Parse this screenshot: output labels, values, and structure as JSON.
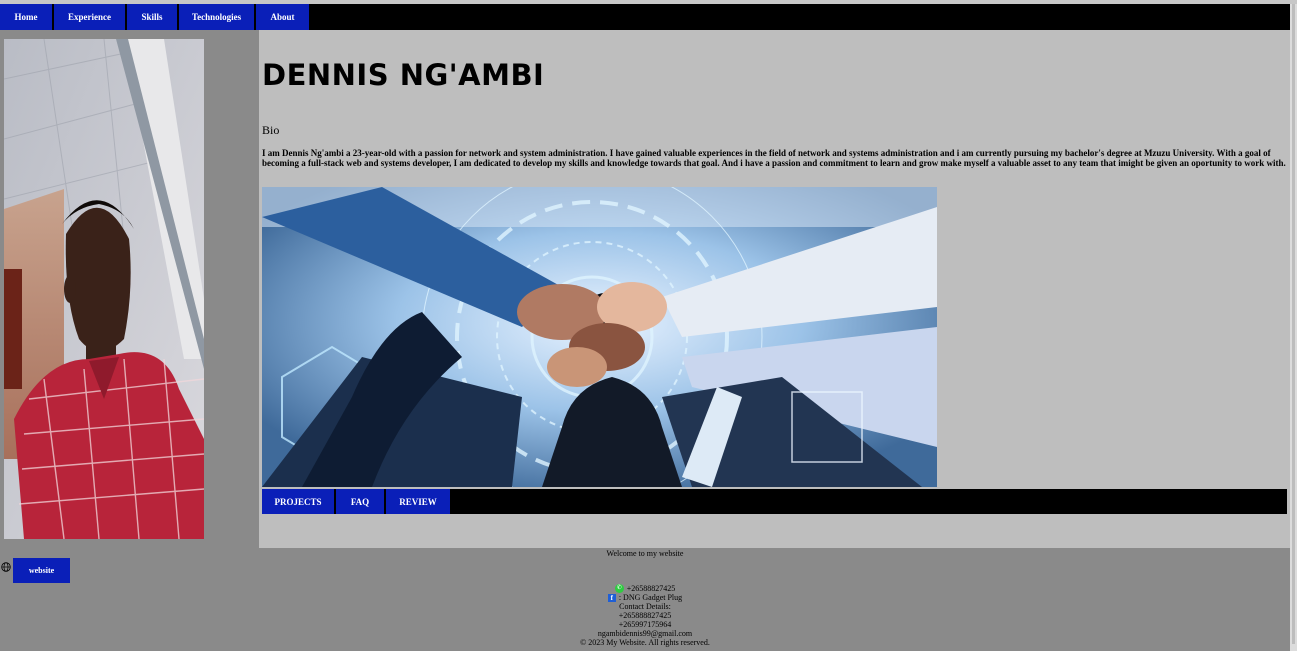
{
  "nav": {
    "items": [
      {
        "label": "Home"
      },
      {
        "label": "Experience"
      },
      {
        "label": "Skills"
      },
      {
        "label": "Technologies"
      },
      {
        "label": "About"
      }
    ]
  },
  "main": {
    "title": "DENNIS NG'AMBI",
    "bio_heading": "Bio",
    "bio_text": "I am Dennis Ng'ambi a 23-year-old with a passion for network and system administration. I have gained valuable experiences in the field of network and systems administration and i am currently pursuing my bachelor's degree at Mzuzu University. With a goal of becoming a full-stack web and systems developer, I am dedicated to develop my skills and knowledge towards that goal. And i have a passion and commitment to learn and grow make myself a valuable asset to any team that imight be given an oportunity to work with."
  },
  "subnav": {
    "items": [
      {
        "label": "PROJECTS"
      },
      {
        "label": "FAQ"
      },
      {
        "label": "REVIEW"
      }
    ]
  },
  "footer": {
    "welcome": "Welcome to my website",
    "website_button": "website",
    "whatsapp": "+26588827425",
    "facebook": ": DNG Gadget Plug",
    "contact_heading": "Contact Details:",
    "phone1": "+265888827425",
    "phone2": "+265997175964",
    "email": "ngambidennis99@gmail.com",
    "copyright": "© 2023 My Website. All rights reserved."
  },
  "colors": {
    "accent": "#0a1fb8",
    "nav_bg": "#000000",
    "main_bg": "#bebebe",
    "sidebar_bg": "#8a8a8a"
  }
}
